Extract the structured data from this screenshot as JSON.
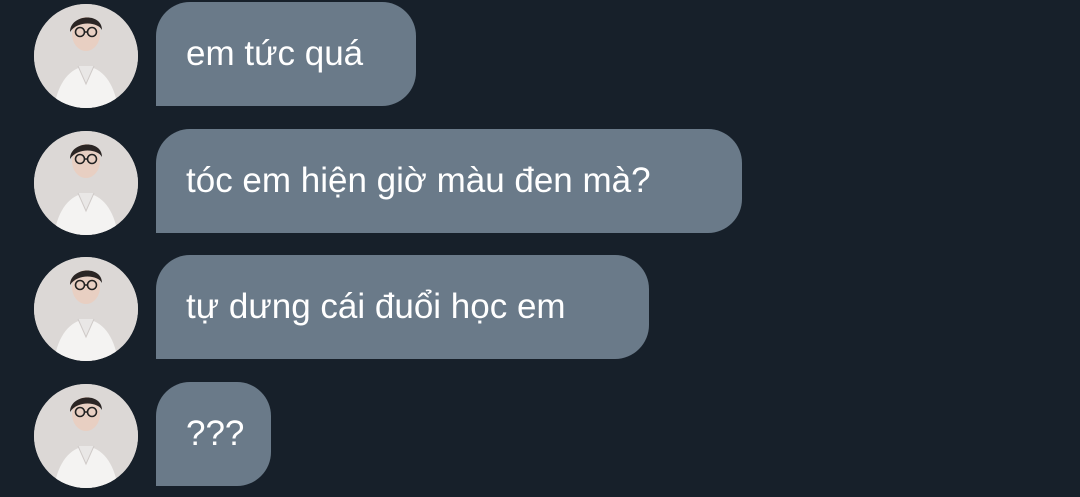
{
  "colors": {
    "background": "#17202a",
    "bubble": "#6a7a89",
    "text": "#ffffff"
  },
  "messages": [
    {
      "text": "em tức quá",
      "avatar_icon": "user-avatar-icon"
    },
    {
      "text": "tóc em hiện giờ màu đen mà?",
      "avatar_icon": "user-avatar-icon"
    },
    {
      "text": "tự dưng cái đuổi học em",
      "avatar_icon": "user-avatar-icon"
    },
    {
      "text": "???",
      "avatar_icon": "user-avatar-icon"
    }
  ]
}
